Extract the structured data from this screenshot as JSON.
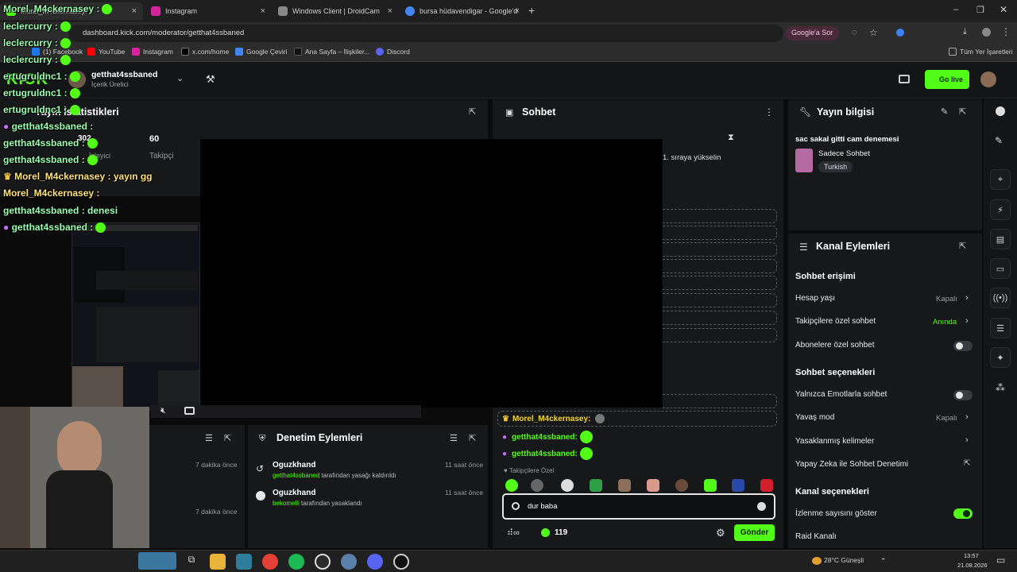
{
  "browser": {
    "tabs": [
      {
        "label": "Morel_M4ckernasey:",
        "active": true
      },
      {
        "label": "Instagram"
      },
      {
        "label": "Windows Client | DroidCam"
      },
      {
        "label": "bursa hüdavendigar - Google'd"
      }
    ],
    "url": "dashboard.kick.com/moderator/getthat4ssbaned",
    "ask_google": "Google'a Sor",
    "bookmarks": [
      "(1) Facebook",
      "YouTube",
      "Instagram",
      "x.com/home",
      "Google Çeviri",
      "Ana Sayfa – İlişkiler...",
      "Discord"
    ],
    "all_bookmarks": "Tüm Yer İşaretleri"
  },
  "header": {
    "logo": "KICK",
    "channel_name": "getthat4ssbaned",
    "role": "İçerik Üretici",
    "go_live": "Go live"
  },
  "stats": {
    "title": "Yayın İstatistikleri",
    "followers_value": "60",
    "followers_label": "Takipçi",
    "second_value": "302",
    "second_label": "İzleyici"
  },
  "chat": {
    "title": "Sohbet",
    "queue_text": "1. sıraya yükselin",
    "messages": [
      {
        "user": "Morel_M4ckernasey:",
        "color": "#f0d43a"
      },
      {
        "user": "getthat4ssbaned:",
        "color": "#53fc18"
      },
      {
        "user": "getthat4ssbaned:",
        "color": "#53fc18"
      }
    ],
    "followers_only_label": "Takipçilere Özel",
    "input_value": "dur baba",
    "points": "119",
    "send": "Gönder"
  },
  "mod_actions": {
    "title": "Denetim Eylemleri",
    "items": [
      {
        "mod": "Oguzkhand",
        "target": "getthat4ssbaned",
        "action": "tarafından yasağı kaldırıldı",
        "time": "11 saat önce"
      },
      {
        "mod": "Oguzkhand",
        "target": "bekomelli",
        "action": "tarafından yasaklandı",
        "time": "11 saat önce"
      }
    ]
  },
  "left_lower": {
    "times": [
      "7 dakika önce",
      "7 dakika önce"
    ]
  },
  "stream_info": {
    "title": "Yayın bilgisi",
    "stream_title": "sac sakal gitti cam denemesi",
    "category": "Sadece Sohbet",
    "tag": "Turkish"
  },
  "channel_actions": {
    "title": "Kanal Eylemleri",
    "chat_access": "Sohbet erişimi",
    "rows1": [
      {
        "label": "Hesap yaşı",
        "value": "Kapalı"
      },
      {
        "label": "Takipçilere özel sohbet",
        "value": "Anında"
      },
      {
        "label": "Abonelere özel sohbet",
        "value": ""
      }
    ],
    "chat_options": "Sohbet seçenekleri",
    "rows2": [
      {
        "label": "Yalnızca Emotlarla sohbet",
        "value": ""
      },
      {
        "label": "Yavaş mod",
        "value": "Kapalı"
      },
      {
        "label": "Yasaklanmış kelimeler",
        "value": ""
      },
      {
        "label": "Yapay Zeka ile Sohbet Denetimi",
        "value": ""
      }
    ],
    "channel_options": "Kanal seçenekleri",
    "rows3": [
      {
        "label": "İzlenme sayısını göster",
        "value": ""
      },
      {
        "label": "Raid Kanalı",
        "value": ""
      }
    ]
  },
  "overlay_chat": [
    {
      "user": "Morel_M4ckernasey :"
    },
    {
      "user": "leclercurry :"
    },
    {
      "user": "leclercurry :"
    },
    {
      "user": "leclercurry :"
    },
    {
      "user": "ertugruldnc1 :"
    },
    {
      "user": "ertugruldnc1 :"
    },
    {
      "user": "ertugruldnc1 :"
    },
    {
      "user": "getthat4ssbaned :"
    },
    {
      "user": "getthat4ssbaned :"
    },
    {
      "user": "getthat4ssbaned :"
    },
    {
      "user": "Morel_M4ckernasey : yayın gg"
    },
    {
      "user": "Morel_M4ckernasey :"
    },
    {
      "user": "getthat4ssbaned : denesi"
    },
    {
      "user": "getthat4ssbaned :"
    }
  ],
  "taskbar": {
    "weather": "28°C Güneşli",
    "time": "13:57",
    "date": "21.08.2026"
  }
}
